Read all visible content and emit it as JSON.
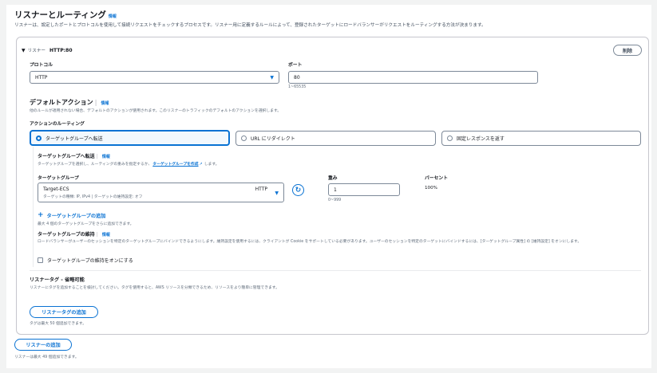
{
  "section": {
    "title": "リスナーとルーティング",
    "info": "情報",
    "description": "リスナーは、設定したポートとプロトコルを使用して接続リクエストをチェックするプロセスです。リスナー用に定義するルールによって、登録されたターゲットにロードバランサーがリクエストをルーティングする方法が決まります。"
  },
  "listener": {
    "toggle_label": "リスナー",
    "name": "HTTP:80",
    "remove_label": "削除",
    "protocol_label": "プロトコル",
    "protocol_value": "HTTP",
    "port_label": "ポート",
    "port_value": "80",
    "port_hint": "1~65535"
  },
  "default_action": {
    "title": "デフォルトアクション",
    "info": "情報",
    "description": "他のルールが適用されない場合、デフォルトのアクションが使用されます。このリスナーのトラフィックのデフォルトのアクションを選択します。",
    "routing_label": "アクションのルーティング",
    "options": [
      "ターゲットグループへ転送",
      "URL にリダイレクト",
      "固定レスポンスを返す"
    ],
    "selected_index": 0
  },
  "forward": {
    "title": "ターゲットグループへ転送",
    "info": "情報",
    "description_prefix": "ターゲットグループを選択し、ルーティングの重みを指定するか、",
    "create_link": "ターゲットグループを作成",
    "description_suffix": "します。",
    "tg_label": "ターゲットグループ",
    "weight_label": "重み",
    "percent_label": "パーセント",
    "tg_name": "Target-ECS",
    "tg_protocol": "HTTP",
    "tg_meta": "ターゲットの種類: IP, IPv4 | ターゲットの維持設定: オフ",
    "weight_value": "1",
    "weight_hint": "0~999",
    "percent_value": "100%",
    "add_tg_label": "ターゲットグループの追加",
    "add_tg_hint": "最大 4 個のターゲットグループをさらに追加できます。"
  },
  "stickiness": {
    "title": "ターゲットグループの維持",
    "info": "情報",
    "description": "ロードバランサーがユーザーのセッションを特定のターゲットグループにバインドできるようにします。維持設定を使用するには、クライアントが Cookie をサポートしている必要があります。ユーザーのセッションを特定のターゲットにバインドするには、[ターゲットグループ属性] の [維持設定] をオンにします。",
    "checkbox_label": "ターゲットグループの維持をオンにする"
  },
  "tags": {
    "title": "リスナータグ - 省略可能",
    "description": "リスナーにタグを追加することを検討してください。タグを使用すると、AWS リソースを分類できるため、リソースをより簡単に管理できます。",
    "add_label": "リスナータグの追加",
    "hint": "タグは最大 50 個追加できます。"
  },
  "footer": {
    "add_listener_label": "リスナーの追加",
    "hint": "リスナーは最大 49 個追加できます。"
  },
  "colors": {
    "accent": "#0972d3",
    "border": "#7d8998",
    "text": "#16191f",
    "muted": "#5f6b7a"
  }
}
